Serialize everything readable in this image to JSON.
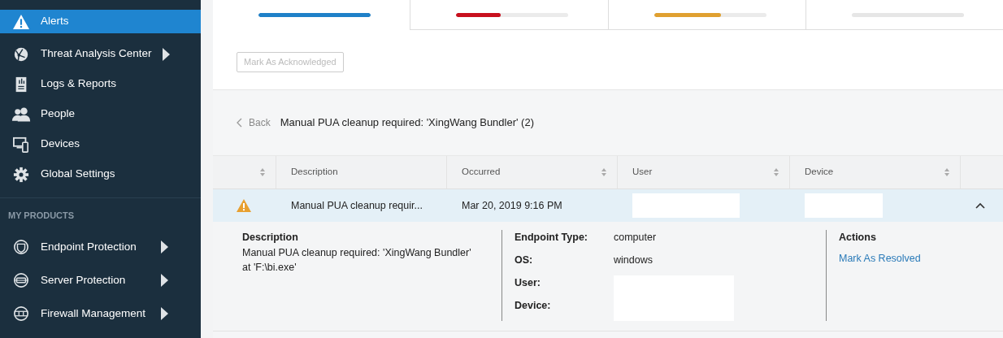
{
  "sidebar": {
    "items": [
      {
        "label": "Alerts",
        "selected": true,
        "submenu": false
      },
      {
        "label": "Threat Analysis Center",
        "selected": false,
        "submenu": true
      },
      {
        "label": "Logs & Reports",
        "selected": false,
        "submenu": false
      },
      {
        "label": "People",
        "selected": false,
        "submenu": false
      },
      {
        "label": "Devices",
        "selected": false,
        "submenu": false
      },
      {
        "label": "Global Settings",
        "selected": false,
        "submenu": false
      }
    ],
    "section_label": "MY PRODUCTS",
    "products": [
      {
        "label": "Endpoint Protection",
        "selected": false,
        "submenu": true
      },
      {
        "label": "Server Protection",
        "selected": false,
        "submenu": true
      },
      {
        "label": "Firewall Management",
        "selected": false,
        "submenu": true
      }
    ]
  },
  "tabs": [
    {
      "selected": true,
      "level": 1,
      "color": "#1f80c8"
    },
    {
      "selected": false,
      "level": 0.4,
      "color": "#c8101e"
    },
    {
      "selected": false,
      "level": 0.6,
      "color": "#e0a030"
    },
    {
      "selected": false,
      "level": 0,
      "color": "#e6e6e6"
    }
  ],
  "toolbar": {
    "button": "Mark As Acknowledged",
    "disabled": true
  },
  "breadcrumb": {
    "back": "Back",
    "title": "Manual PUA cleanup required: 'XingWang Bundler' (2)"
  },
  "table": {
    "columns": [
      {
        "sortable": true
      },
      {
        "label": "Description",
        "sortable": false
      },
      {
        "label": "Occurred",
        "sortable": true
      },
      {
        "label": "User",
        "sortable": true
      },
      {
        "label": "Device",
        "sortable": true
      }
    ],
    "rows": [
      {
        "description": "Manual PUA cleanup requir...",
        "occurred": "Mar 20, 2019 9:16 PM",
        "user_redacted": true,
        "device_redacted": true,
        "expanded": true
      }
    ]
  },
  "details": {
    "description_heading": "Description",
    "description": "Manual PUA cleanup required: 'XingWang Bundler' at 'F:\\bi.exe'",
    "fields": [
      {
        "label": "Endpoint Type:",
        "value": "computer",
        "redacted": false
      },
      {
        "label": "OS:",
        "value": "windows",
        "redacted": false
      },
      {
        "label": "User:",
        "redacted": true
      },
      {
        "label": "Device:",
        "redacted": true
      }
    ],
    "actions_heading": "Actions",
    "action": "Mark As Resolved"
  }
}
